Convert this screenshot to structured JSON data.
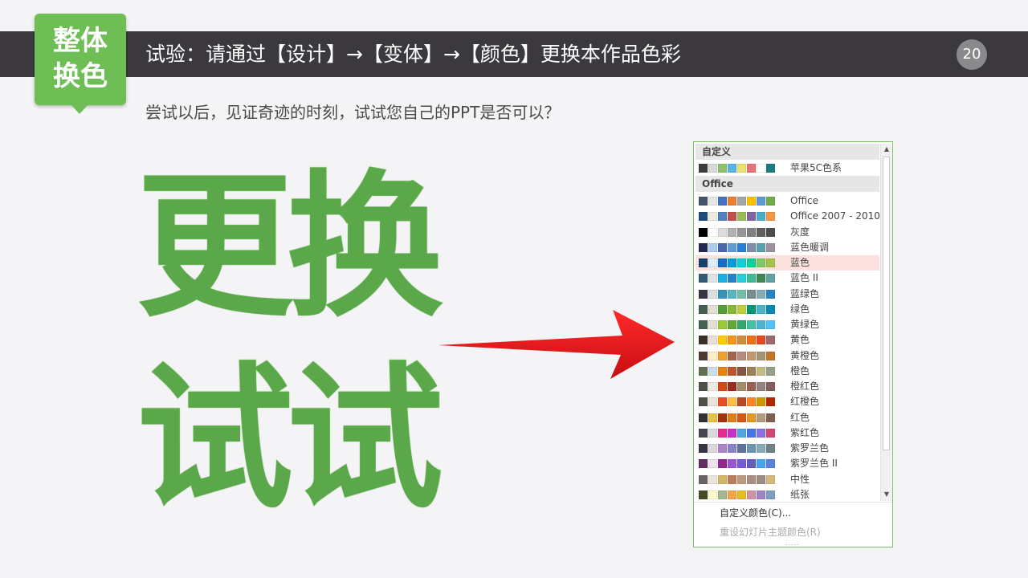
{
  "header": {
    "title": "试验：请通过【设计】→【变体】→【颜色】更换本作品色彩",
    "page_number": "20"
  },
  "badge": {
    "line1": "整体",
    "line2": "换色"
  },
  "subtitle": "尝试以后，见证奇迹的时刻，试试您自己的PPT是否可以？",
  "big_text": {
    "line1": "更换",
    "line2": "试试"
  },
  "colors": {
    "accent_green": "#6fbe55",
    "header_bg": "#3b393d",
    "arrow_red": "#e4141b",
    "highlight": "#fbe2de"
  },
  "color_panel": {
    "custom_section": "自定义",
    "custom_items": [
      {
        "label": "苹果5C色系",
        "colors": [
          "#3c3c3c",
          "#d8d8d8",
          "#8fc16d",
          "#5ab4e0",
          "#e9e36b",
          "#e57378",
          "#ffffff",
          "#1a7c80"
        ]
      }
    ],
    "office_section": "Office",
    "items": [
      {
        "label": "Office",
        "colors": [
          "#44546a",
          "#e7e6e6",
          "#4472c4",
          "#ed7d31",
          "#a5a5a5",
          "#ffc000",
          "#5b9bd5",
          "#70ad47"
        ]
      },
      {
        "label": "Office 2007 - 2010",
        "colors": [
          "#1f497d",
          "#eeece1",
          "#4f81bd",
          "#c0504d",
          "#9bbb59",
          "#8064a2",
          "#4bacc6",
          "#f79646"
        ]
      },
      {
        "label": "灰度",
        "colors": [
          "#000000",
          "#ffffff",
          "#dddddd",
          "#b2b2b2",
          "#969696",
          "#808080",
          "#5f5f5f",
          "#4d4d4d"
        ]
      },
      {
        "label": "蓝色暖调",
        "colors": [
          "#242852",
          "#acccea",
          "#4a66ac",
          "#629dd1",
          "#297fd5",
          "#7f8fa9",
          "#5aa2ae",
          "#9d90a0"
        ]
      },
      {
        "label": "蓝色",
        "colors": [
          "#17406d",
          "#dbeff9",
          "#0f6fc6",
          "#009dd9",
          "#0bd0d9",
          "#10cf9b",
          "#7cca62",
          "#a5c249"
        ]
      },
      {
        "label": "蓝色 II",
        "colors": [
          "#335b74",
          "#dfe3e5",
          "#1cade4",
          "#2683c6",
          "#27ced7",
          "#42ba97",
          "#3e8853",
          "#62a39f"
        ]
      },
      {
        "label": "蓝绿色",
        "colors": [
          "#373545",
          "#dedede",
          "#3494ba",
          "#58b6c0",
          "#75bda7",
          "#7a8c8e",
          "#84acb6",
          "#2683c6"
        ]
      },
      {
        "label": "绿色",
        "colors": [
          "#455f51",
          "#e3ded1",
          "#549e39",
          "#8ab833",
          "#c0cf3a",
          "#029676",
          "#4ab5c4",
          "#0989b1"
        ]
      },
      {
        "label": "黄绿色",
        "colors": [
          "#455f51",
          "#e3ded1",
          "#99cb38",
          "#63a537",
          "#37a76f",
          "#44c1a3",
          "#4eb3cf",
          "#51c3f9"
        ]
      },
      {
        "label": "黄色",
        "colors": [
          "#39302a",
          "#e5dedb",
          "#ffca08",
          "#f8931d",
          "#ce8d3e",
          "#ec7016",
          "#e64823",
          "#9c6a6a"
        ]
      },
      {
        "label": "黄橙色",
        "colors": [
          "#4e3b30",
          "#fbeec9",
          "#f0a22e",
          "#a5644e",
          "#b58b80",
          "#c3986d",
          "#a19574",
          "#c17529"
        ]
      },
      {
        "label": "橙色",
        "colors": [
          "#637052",
          "#ccddea",
          "#e48312",
          "#bd582c",
          "#865640",
          "#9b8357",
          "#c2bc80",
          "#94a088"
        ]
      },
      {
        "label": "橙红色",
        "colors": [
          "#505046",
          "#eeece1",
          "#d34817",
          "#9b2d1f",
          "#a28e6a",
          "#956251",
          "#918485",
          "#855d5d"
        ]
      },
      {
        "label": "红橙色",
        "colors": [
          "#505046",
          "#e9e5dc",
          "#e84c22",
          "#ffbd47",
          "#b64926",
          "#ff8427",
          "#cc9900",
          "#b22600"
        ]
      },
      {
        "label": "红色",
        "colors": [
          "#323232",
          "#e5c243",
          "#a5300f",
          "#de7e18",
          "#d55816",
          "#e19825",
          "#b19c7d",
          "#7f5f52"
        ]
      },
      {
        "label": "紫红色",
        "colors": [
          "#454551",
          "#d8d9dc",
          "#e32d91",
          "#c830cc",
          "#4ea6dc",
          "#4775e7",
          "#8971e1",
          "#d54773"
        ]
      },
      {
        "label": "紫罗兰色",
        "colors": [
          "#373545",
          "#dcd8dc",
          "#ad84c6",
          "#8784c7",
          "#5d739a",
          "#6997af",
          "#84acb6",
          "#6f8183"
        ]
      },
      {
        "label": "紫罗兰色 II",
        "colors": [
          "#632e62",
          "#eae5eb",
          "#92278f",
          "#9b57d3",
          "#755dd9",
          "#665eb8",
          "#45a5ed",
          "#5982db"
        ]
      },
      {
        "label": "中性",
        "colors": [
          "#696464",
          "#e9e5dc",
          "#d3b86a",
          "#bb7e5b",
          "#bd9b83",
          "#a99087",
          "#9c8c84",
          "#d4b87f"
        ]
      },
      {
        "label": "纸张",
        "colors": [
          "#444d26",
          "#fefac9",
          "#a5b592",
          "#f3a447",
          "#e7bc29",
          "#d092a7",
          "#9c85c0",
          "#809ec2"
        ]
      }
    ],
    "highlighted_item": "蓝色",
    "action_custom": "自定义颜色(C)...",
    "action_reset": "重设幻灯片主题颜色(R)",
    "grip": "....."
  }
}
